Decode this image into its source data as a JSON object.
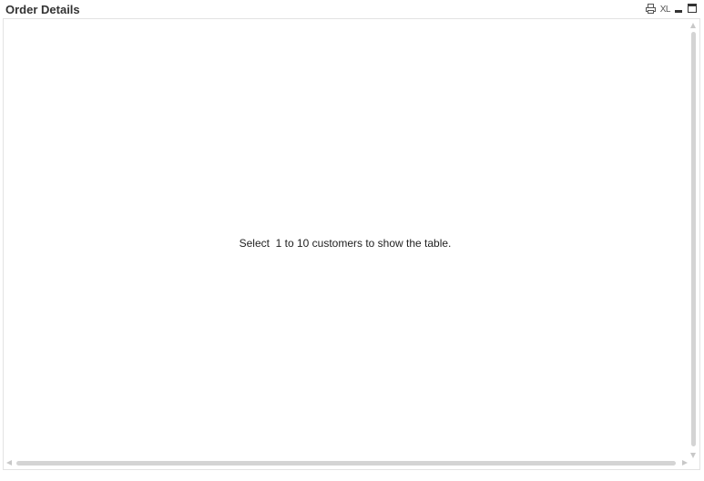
{
  "window": {
    "title": "Order Details",
    "icons": {
      "print": "print-icon",
      "excel": "XL",
      "minimize": "minimize-icon",
      "maximize": "maximize-icon"
    }
  },
  "content": {
    "empty_message": "Select  1 to 10 customers to show the table."
  },
  "colors": {
    "title": "#333333",
    "border": "#e3e3e3",
    "scrollbar": "#d4d4d4"
  }
}
